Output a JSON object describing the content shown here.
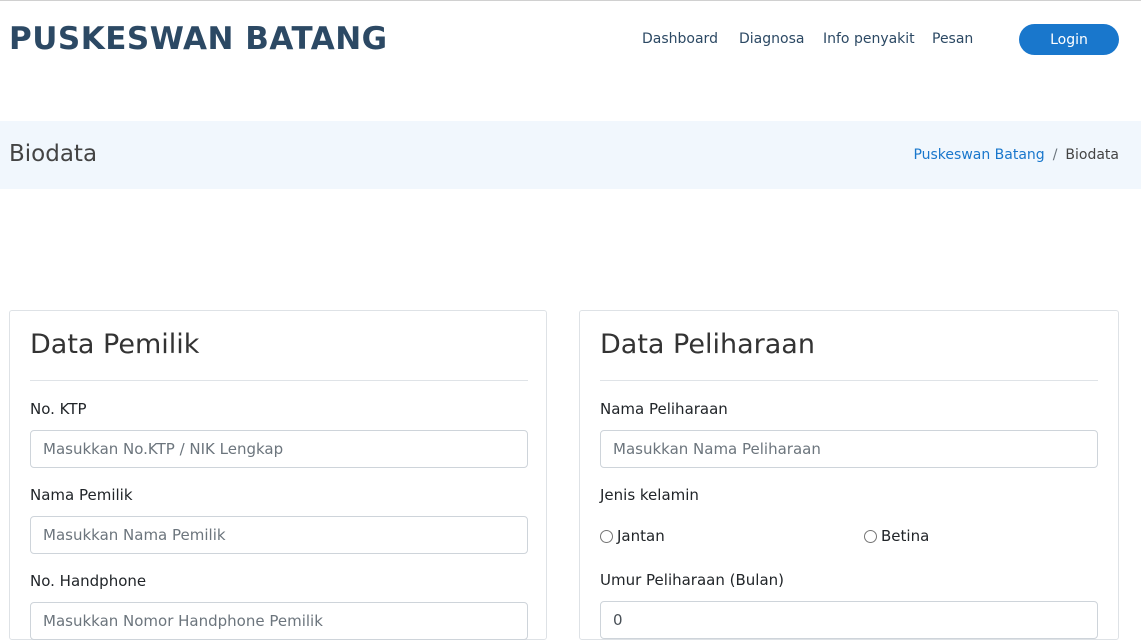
{
  "brand": "PUSKESWAN BATANG",
  "nav": {
    "items": [
      {
        "label": "Dashboard"
      },
      {
        "label": "Diagnosa"
      },
      {
        "label": "Info penyakit"
      },
      {
        "label": "Pesan"
      }
    ],
    "login": "Login"
  },
  "breadcrumb": {
    "title": "Biodata",
    "home": "Puskeswan Batang",
    "separator": "/",
    "current": "Biodata"
  },
  "owner": {
    "title": "Data Pemilik",
    "ktp_label": "No. KTP",
    "ktp_placeholder": "Masukkan No.KTP / NIK Lengkap",
    "name_label": "Nama Pemilik",
    "name_placeholder": "Masukkan Nama Pemilik",
    "phone_label": "No. Handphone",
    "phone_placeholder": "Masukkan Nomor Handphone Pemilik"
  },
  "pet": {
    "title": "Data Peliharaan",
    "name_label": "Nama Peliharaan",
    "name_placeholder": "Masukkan Nama Peliharaan",
    "gender_label": "Jenis kelamin",
    "gender_male": "Jantan",
    "gender_female": "Betina",
    "age_label": "Umur Peliharaan (Bulan)",
    "age_value": "0"
  },
  "colors": {
    "brand": "#2c4964",
    "accent": "#1977cc",
    "breadcrumb_bg": "#f1f7fd"
  }
}
